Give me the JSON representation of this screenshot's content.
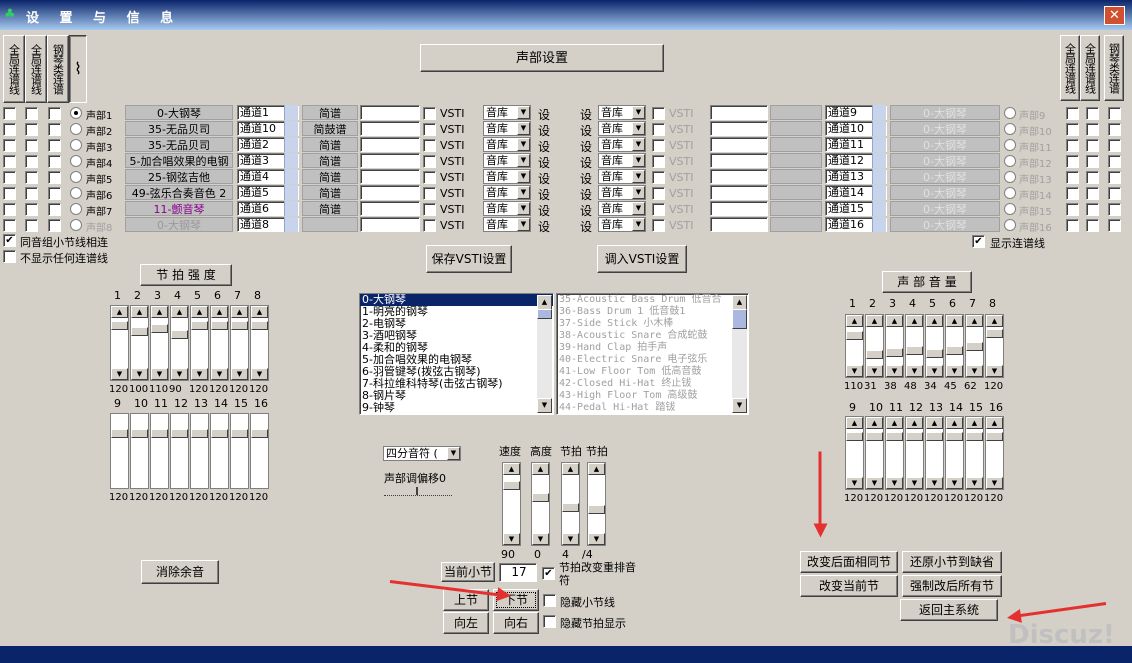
{
  "title": "设 置 与 信 息",
  "left_vertical": [
    "全局连谱线",
    "全局连谱线",
    "钢琴类连谱"
  ],
  "right_vertical": [
    "全局连谱线",
    "全局连谱线",
    "钢琴类连谱"
  ],
  "voice_settings_button": "声部设置",
  "parts_left": [
    {
      "radio": "声部1",
      "instrument": "0-大钢琴",
      "channel": "通道1",
      "mode": "简谱",
      "vst": "VSTI",
      "lib": "音库",
      "set": "设"
    },
    {
      "radio": "声部2",
      "instrument": "35-无品贝司",
      "channel": "通道10",
      "mode": "简鼓谱",
      "vst": "VSTI",
      "lib": "音库",
      "set": "设"
    },
    {
      "radio": "声部3",
      "instrument": "35-无品贝司",
      "channel": "通道2",
      "mode": "简谱",
      "vst": "VSTI",
      "lib": "音库",
      "set": "设"
    },
    {
      "radio": "声部4",
      "instrument": "5-加合唱效果的电钢",
      "channel": "通道3",
      "mode": "简谱",
      "vst": "VSTI",
      "lib": "音库",
      "set": "设"
    },
    {
      "radio": "声部5",
      "instrument": "25-钢弦吉他",
      "channel": "通道4",
      "mode": "简谱",
      "vst": "VSTI",
      "lib": "音库",
      "set": "设"
    },
    {
      "radio": "声部6",
      "instrument": "49-弦乐合奏音色 2",
      "channel": "通道5",
      "mode": "简谱",
      "vst": "VSTI",
      "lib": "音库",
      "set": "设"
    },
    {
      "radio": "声部7",
      "instrument": "11-颤音琴",
      "channel": "通道6",
      "mode": "简谱",
      "vst": "VSTI",
      "lib": "音库",
      "set": "设"
    },
    {
      "radio": "声部8",
      "instrument": "0-大钢琴",
      "channel": "通道8",
      "mode": "",
      "vst": "VSTI",
      "lib": "音库",
      "set": "设"
    }
  ],
  "parts_right": [
    {
      "set": "设",
      "lib": "音库",
      "vst": "VSTI",
      "channel": "通道9",
      "instrument": "0-大钢琴",
      "radio": "声部9"
    },
    {
      "set": "设",
      "lib": "音库",
      "vst": "VSTI",
      "channel": "通道10",
      "instrument": "0-大钢琴",
      "radio": "声部10"
    },
    {
      "set": "设",
      "lib": "音库",
      "vst": "VSTI",
      "channel": "通道11",
      "instrument": "0-大钢琴",
      "radio": "声部11"
    },
    {
      "set": "设",
      "lib": "音库",
      "vst": "VSTI",
      "channel": "通道12",
      "instrument": "0-大钢琴",
      "radio": "声部12"
    },
    {
      "set": "设",
      "lib": "音库",
      "vst": "VSTI",
      "channel": "通道13",
      "instrument": "0-大钢琴",
      "radio": "声部13"
    },
    {
      "set": "设",
      "lib": "音库",
      "vst": "VSTI",
      "channel": "通道14",
      "instrument": "0-大钢琴",
      "radio": "声部14"
    },
    {
      "set": "设",
      "lib": "音库",
      "vst": "VSTI",
      "channel": "通道15",
      "instrument": "0-大钢琴",
      "radio": "声部15"
    },
    {
      "set": "设",
      "lib": "音库",
      "vst": "VSTI",
      "channel": "通道16",
      "instrument": "0-大钢琴",
      "radio": "声部16"
    }
  ],
  "check_same_group": "同音组小节线相连",
  "check_no_link": "不显示任何连谱线",
  "check_show_link": "显示连谱线",
  "save_vsti": "保存VSTI设置",
  "load_vsti": "调入VSTI设置",
  "beat_strength_title": "节 拍 强 度",
  "beat_nums_top": [
    "1",
    "2",
    "3",
    "4",
    "5",
    "6",
    "7",
    "8"
  ],
  "beat_vals_top": [
    "120",
    "100",
    "110",
    "90",
    "120",
    "120",
    "120",
    "120"
  ],
  "beat_nums_bottom": [
    "9",
    "10",
    "11",
    "12",
    "13",
    "14",
    "15",
    "16"
  ],
  "beat_vals_bottom": [
    "120",
    "120",
    "120",
    "120",
    "120",
    "120",
    "120",
    "120"
  ],
  "voice_volume_title": "声 部 音 量",
  "vol_nums_top": [
    "1",
    "2",
    "3",
    "4",
    "5",
    "6",
    "7",
    "8"
  ],
  "vol_vals_top": [
    "110",
    "31",
    "38",
    "48",
    "34",
    "45",
    "62",
    "120"
  ],
  "vol_nums_bottom": [
    "9",
    "10",
    "11",
    "12",
    "13",
    "14",
    "15",
    "16"
  ],
  "vol_vals_bottom": [
    "120",
    "120",
    "120",
    "120",
    "120",
    "120",
    "120",
    "120"
  ],
  "instrument_list": [
    "0-大钢琴",
    "1-明亮的钢琴",
    "2-电钢琴",
    "3-酒吧钢琴",
    "4-柔和的钢琴",
    "5-加合唱效果的电钢琴",
    "6-羽管键琴(拨弦古钢琴)",
    "7-科拉维科特琴(击弦古钢琴)",
    "8-钢片琴",
    "9-钟琴"
  ],
  "drum_list": [
    "35-Acoustic Bass Drum  低音合",
    "36-Bass Drum 1 低音鼓1",
    "37-Side Stick 小木棒",
    "38-Acoustic Snare 合成蛇鼓",
    "39-Hand Clap 拍手声",
    "40-Electric Snare 电子弦乐",
    "41-Low Floor Tom 低高音鼓",
    "42-Closed Hi-Hat 终止钹",
    "43-High Floor Tom 高级鼓",
    "44-Pedal Hi-Hat 踏钹"
  ],
  "note_select": "四分音符 (",
  "voice_offset_label": "声部调偏移0",
  "speed_labels": [
    "速度",
    "高度",
    "节拍",
    "节拍"
  ],
  "speed_vals": [
    "90",
    "0",
    "4",
    "/4"
  ],
  "clear_sound": "消除余音",
  "current_bar_label": "当前小节",
  "current_bar_value": "17",
  "check_beat_rearrange": "节拍改变重排音符",
  "btn_prev": "上节",
  "btn_next": "下节",
  "btn_left": "向左",
  "btn_right": "向右",
  "check_hide_bar": "隐藏小节线",
  "check_hide_beat": "隐藏节拍显示",
  "btn_change_later": "改变后面相同节",
  "btn_restore_default": "还原小节到缺省",
  "btn_change_current": "改变当前节",
  "btn_force_all": "强制改后所有节",
  "btn_return_main": "返回主系统",
  "watermark": "Discuz!"
}
